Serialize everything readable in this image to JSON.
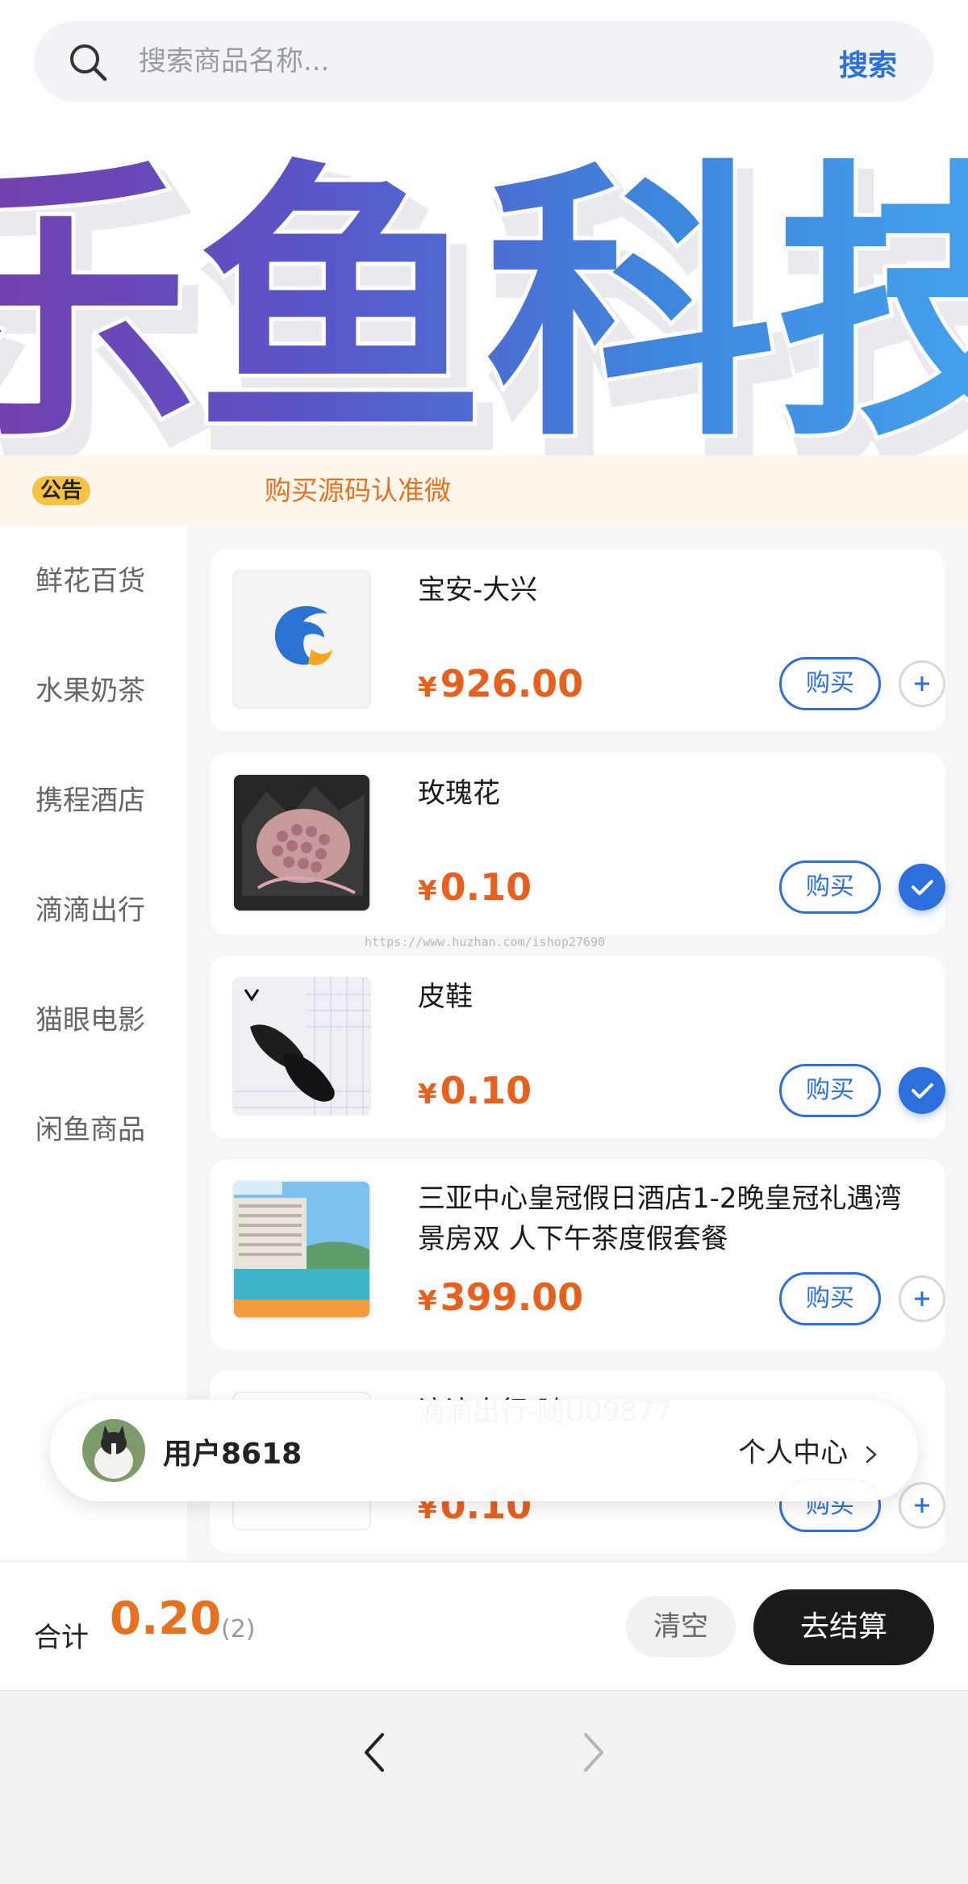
{
  "search": {
    "placeholder": "搜索商品名称...",
    "button_label": "搜索"
  },
  "banner": {
    "text": "乐鱼科技",
    "gradient_colors": [
      "#7b3aa8",
      "#5a55c8",
      "#3e86de",
      "#46a8f0"
    ]
  },
  "notice": {
    "badge": "公告",
    "text": "购买源码认准微"
  },
  "categories": [
    {
      "label": "鲜花百货"
    },
    {
      "label": "水果奶茶"
    },
    {
      "label": "携程酒店"
    },
    {
      "label": "滴滴出行"
    },
    {
      "label": "猫眼电影"
    },
    {
      "label": "闲鱼商品"
    }
  ],
  "products": [
    {
      "name": "宝安-大兴",
      "currency": "¥",
      "price": "926.00",
      "buy_label": "购买",
      "added": false,
      "image": "ctrip-logo-icon"
    },
    {
      "name": "玫瑰花",
      "currency": "¥",
      "price": "0.10",
      "buy_label": "购买",
      "added": true,
      "image": "rose-bouquet-photo"
    },
    {
      "name": "皮鞋",
      "currency": "¥",
      "price": "0.10",
      "buy_label": "购买",
      "added": true,
      "image": "leather-shoes-photo"
    },
    {
      "name": "三亚中心皇冠假日酒店1-2晚皇冠礼遇湾景房双 人下午茶度假套餐",
      "currency": "¥",
      "price": "399.00",
      "buy_label": "购买",
      "added": false,
      "image": "hotel-pool-photo"
    },
    {
      "name": "滴滴出行-随U09877",
      "currency": "¥",
      "price": "0.10",
      "buy_label": "购买",
      "added": false,
      "image": "placeholder"
    }
  ],
  "watermark": "https://www.huzhan.com/ishop27690",
  "user": {
    "name": "用户8618",
    "profile_link": "个人中心"
  },
  "checkout": {
    "total_label": "合计",
    "total_value": "0.20",
    "count": "(2)",
    "clear_label": "清空",
    "checkout_label": "去结算"
  },
  "colors": {
    "accent": "#2d6fdc",
    "price": "#e8601e",
    "notice_bg": "#fdf6ec",
    "badge": "#f5c242"
  }
}
